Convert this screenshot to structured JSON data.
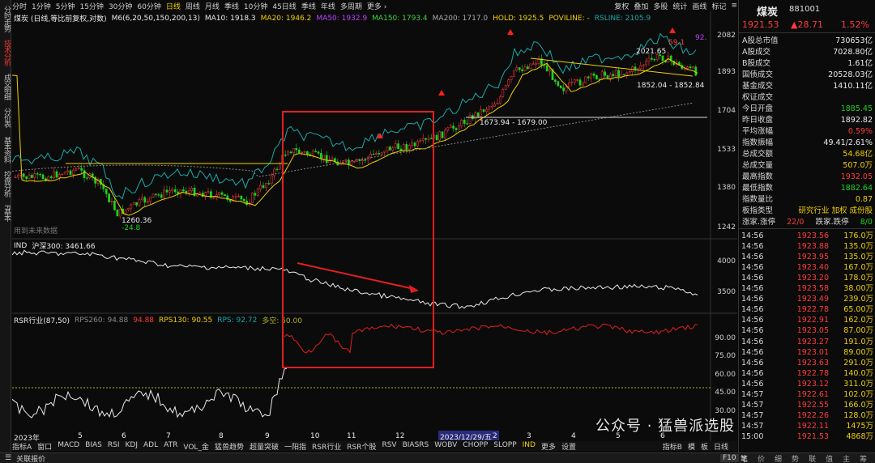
{
  "left_rail": [
    {
      "label": "分时走势",
      "active": false
    },
    {
      "label": "技术分析",
      "active": true
    },
    {
      "label": "成交明细",
      "active": false
    },
    {
      "label": "分价表",
      "active": false
    },
    {
      "label": "基本资料",
      "active": false
    },
    {
      "label": "控盘分析",
      "active": false
    },
    {
      "label": "F基本",
      "active": false
    }
  ],
  "periods": [
    "分时",
    "1分钟",
    "5分钟",
    "15分钟",
    "30分钟",
    "60分钟",
    "日线",
    "周线",
    "月线",
    "季线",
    "10分钟",
    "45日线",
    "季线",
    "年线",
    "多周期",
    "更多 ›"
  ],
  "active_period": "日线",
  "tools": [
    "复权",
    "叠加",
    "多股",
    "统计",
    "画线",
    "标记"
  ],
  "title": {
    "name": "煤炭",
    "code": "881001",
    "price": "1921.53",
    "change": "▲28.71",
    "pct": "1.52%"
  },
  "main_legend": {
    "label": "煤炭 (日线,等比前复权,对数)",
    "m6": "M6(6,20,50,150,200,13)",
    "ma10": "MA10: 1918.3",
    "ma20": "MA20: 1946.2",
    "ma50": "MA50: 1932.9",
    "ma150": "MA150: 1793.4",
    "ma200": "MA200: 1717.0",
    "hold": "HOLD: 1925.5",
    "poviline": "POVILINE: -",
    "rsline": "RSLINE: 2105.9"
  },
  "ind_legend": {
    "name": "IND",
    "value": "沪深300: 3461.66"
  },
  "rsr_legend": {
    "name": "RSR行业(87,50)",
    "rps260": "RPS260: 94.88",
    "rps260b": "94.88",
    "rps130": "RPS130: 90.55",
    "rps": "RPS: 92.72",
    "duokong": "多空: 50.00"
  },
  "annotations": {
    "high": "2021.65",
    "high2": "59.1",
    "low": "1260.36",
    "low2": "-24.8",
    "range1": "1852.04 - 1852.84",
    "range2": "1673.94 - 1679.00",
    "poviline_tag": "92.",
    "no_future": "用到未来数据",
    "date_cursor": "2023/12/29/五"
  },
  "y_axis_main": [
    "2082",
    "1893",
    "1704",
    "1533",
    "1380",
    "1242"
  ],
  "y_axis_ind": [
    "4000",
    "3500"
  ],
  "y_axis_rsr": [
    "90.00",
    "75.00",
    "60.00",
    "45.00",
    "30.00"
  ],
  "x_axis": [
    "2023年",
    "5",
    "6",
    "7",
    "8",
    "9",
    "10",
    "11",
    "12",
    "2",
    "3",
    "4",
    "5",
    "6"
  ],
  "stats": [
    {
      "k": "A股总市值",
      "v": "730653亿",
      "c": "white"
    },
    {
      "k": "A股成交",
      "v": "7028.80亿",
      "c": "white"
    },
    {
      "k": "B股成交",
      "v": "1.61亿",
      "c": "white"
    },
    {
      "k": "国债成交",
      "v": "20528.03亿",
      "c": "white"
    },
    {
      "k": "基金成交",
      "v": "1410.11亿",
      "c": "white"
    },
    {
      "k": "权证成交",
      "v": "",
      "c": "white"
    },
    {
      "k": "今日开盘",
      "v": "1885.45",
      "c": "green"
    },
    {
      "k": "昨日收盘",
      "v": "1892.82",
      "c": "white"
    },
    {
      "k": "平均涨幅",
      "v": "0.59%",
      "c": "red"
    },
    {
      "k": "指数振幅",
      "v": "49.41/2.61%",
      "c": "white"
    },
    {
      "k": "总成交额",
      "v": "54.68亿",
      "c": "yellow"
    },
    {
      "k": "总成交量",
      "v": "507.0万",
      "c": "yellow"
    },
    {
      "k": "最高指数",
      "v": "1932.05",
      "c": "red"
    },
    {
      "k": "最低指数",
      "v": "1882.64",
      "c": "green"
    },
    {
      "k": "指数量比",
      "v": "0.87",
      "c": "yellow"
    }
  ],
  "sector": {
    "k": "板指类型",
    "v": "研究行业 加权 成份股"
  },
  "updown": {
    "k1": "涨家.涨停",
    "v1": "22/0",
    "k2": "跌家.跌停",
    "v2": "8/0"
  },
  "ticks": [
    {
      "t": "14:56",
      "p": "1923.56",
      "v": "176.0万",
      "pc": "red"
    },
    {
      "t": "14:56",
      "p": "1923.88",
      "v": "135.0万",
      "pc": "red"
    },
    {
      "t": "14:56",
      "p": "1923.95",
      "v": "135.0万",
      "pc": "red"
    },
    {
      "t": "14:56",
      "p": "1923.40",
      "v": "167.0万",
      "pc": "red"
    },
    {
      "t": "14:56",
      "p": "1923.20",
      "v": "178.0万",
      "pc": "red"
    },
    {
      "t": "14:56",
      "p": "1923.58",
      "v": "38.00万",
      "pc": "red"
    },
    {
      "t": "14:56",
      "p": "1923.49",
      "v": "239.0万",
      "pc": "red"
    },
    {
      "t": "14:56",
      "p": "1922.78",
      "v": "65.00万",
      "pc": "red"
    },
    {
      "t": "14:56",
      "p": "1922.91",
      "v": "162.0万",
      "pc": "red"
    },
    {
      "t": "14:56",
      "p": "1923.05",
      "v": "87.00万",
      "pc": "red"
    },
    {
      "t": "14:56",
      "p": "1923.27",
      "v": "191.0万",
      "pc": "red"
    },
    {
      "t": "14:56",
      "p": "1923.01",
      "v": "89.00万",
      "pc": "red"
    },
    {
      "t": "14:56",
      "p": "1923.63",
      "v": "291.0万",
      "pc": "red"
    },
    {
      "t": "14:56",
      "p": "1922.78",
      "v": "140.0万",
      "pc": "red"
    },
    {
      "t": "14:56",
      "p": "1923.12",
      "v": "311.0万",
      "pc": "red"
    },
    {
      "t": "14:57",
      "p": "1922.61",
      "v": "102.0万",
      "pc": "red"
    },
    {
      "t": "14:57",
      "p": "1922.55",
      "v": "166.0万",
      "pc": "red"
    },
    {
      "t": "14:57",
      "p": "1922.26",
      "v": "128.0万",
      "pc": "red"
    },
    {
      "t": "14:57",
      "p": "1922.11",
      "v": "1475万",
      "pc": "red"
    },
    {
      "t": "15:00",
      "p": "1921.53",
      "v": "4868万",
      "pc": "red"
    }
  ],
  "bottom_tabs": [
    "指标A",
    "窗口",
    "MACD",
    "BIAS",
    "RSI",
    "KDJ",
    "ADL",
    "ATR",
    "VOL_金",
    "猛兽趋势",
    "超量突破",
    "一阳指",
    "RSR行业",
    "RSR个股",
    "RSV",
    "BIASRS",
    "WOBV",
    "CHOPP",
    "SLOPP",
    "IND",
    "更多",
    "设置"
  ],
  "active_bottom_tab": "IND",
  "bottom_right": [
    "指标B",
    "模",
    "板",
    "日线"
  ],
  "status": {
    "label": "关联报价",
    "f10": "F10",
    "right_tabs": [
      "笔",
      "价",
      "细",
      "势",
      "联",
      "值",
      "主",
      "筹"
    ]
  },
  "watermark": "公众号 · 猛兽派选股",
  "colors": {
    "up": "#ff3b3b",
    "down": "#1fd21f",
    "ma20": "#f0d000",
    "rsline": "#1aa8a8",
    "box": "#e02020"
  }
}
